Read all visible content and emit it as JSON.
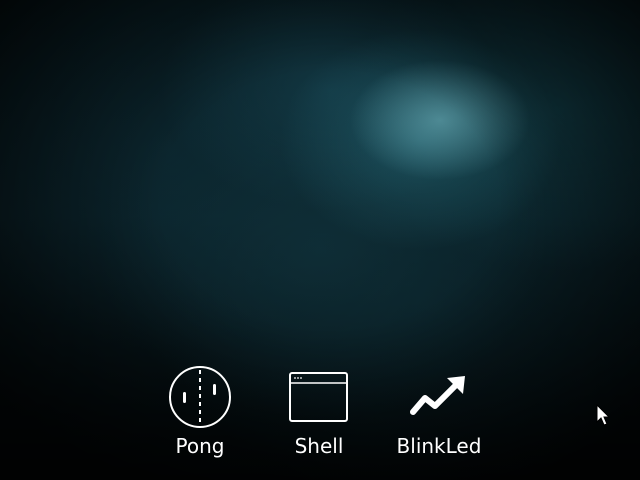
{
  "desktop": {
    "icons": [
      {
        "label": "Pong",
        "icon": "pong-icon"
      },
      {
        "label": "Shell",
        "icon": "terminal-window-icon"
      },
      {
        "label": "BlinkLed",
        "icon": "trend-arrow-icon"
      }
    ]
  },
  "colors": {
    "icon_foreground": "#ffffff",
    "wallpaper_dark": "#061216",
    "wallpaper_highlight": "#78bec8"
  },
  "cursor": {
    "icon": "arrow-cursor-icon"
  }
}
